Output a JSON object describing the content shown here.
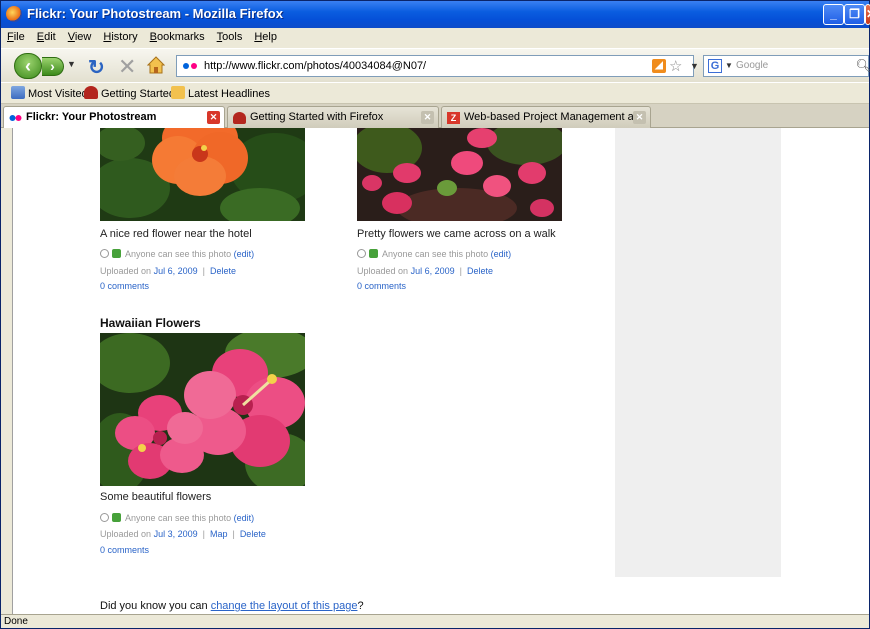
{
  "window": {
    "title": "Flickr: Your Photostream - Mozilla Firefox"
  },
  "menu": [
    "File",
    "Edit",
    "View",
    "History",
    "Bookmarks",
    "Tools",
    "Help"
  ],
  "nav": {
    "url": "http://www.flickr.com/photos/40034084@N07/",
    "search_placeholder": "Google"
  },
  "bookmarks": [
    "Most Visited",
    "Getting Started",
    "Latest Headlines"
  ],
  "tabs": [
    {
      "label": "Flickr: Your Photostream"
    },
    {
      "label": "Getting Started with Firefox"
    },
    {
      "label": "Web-based Project Management and C..."
    }
  ],
  "photos": [
    {
      "caption": "A nice red flower near the hotel",
      "permission": "Anyone can see this photo",
      "edit": "(edit)",
      "uploaded_prefix": "Uploaded on",
      "date": "Jul 6, 2009",
      "delete": "Delete",
      "comments": "0 comments"
    },
    {
      "caption": "Pretty flowers we came across on a walk",
      "permission": "Anyone can see this photo",
      "edit": "(edit)",
      "uploaded_prefix": "Uploaded on",
      "date": "Jul 6, 2009",
      "delete": "Delete",
      "comments": "0 comments"
    },
    {
      "set_title": "Hawaiian Flowers",
      "caption": "Some beautiful flowers",
      "permission": "Anyone can see this photo",
      "edit": "(edit)",
      "uploaded_prefix": "Uploaded on",
      "date": "Jul 3, 2009",
      "map": "Map",
      "delete": "Delete",
      "comments": "0 comments"
    }
  ],
  "tip": {
    "prefix": "Did you know you can",
    "link": "change the layout of this page",
    "suffix": "?"
  },
  "status": "Done",
  "colors": {
    "link": "#2a64c8",
    "title_bar": "#0a5de0",
    "flickr_blue": "#0063dc",
    "flickr_pink": "#ff0084"
  }
}
